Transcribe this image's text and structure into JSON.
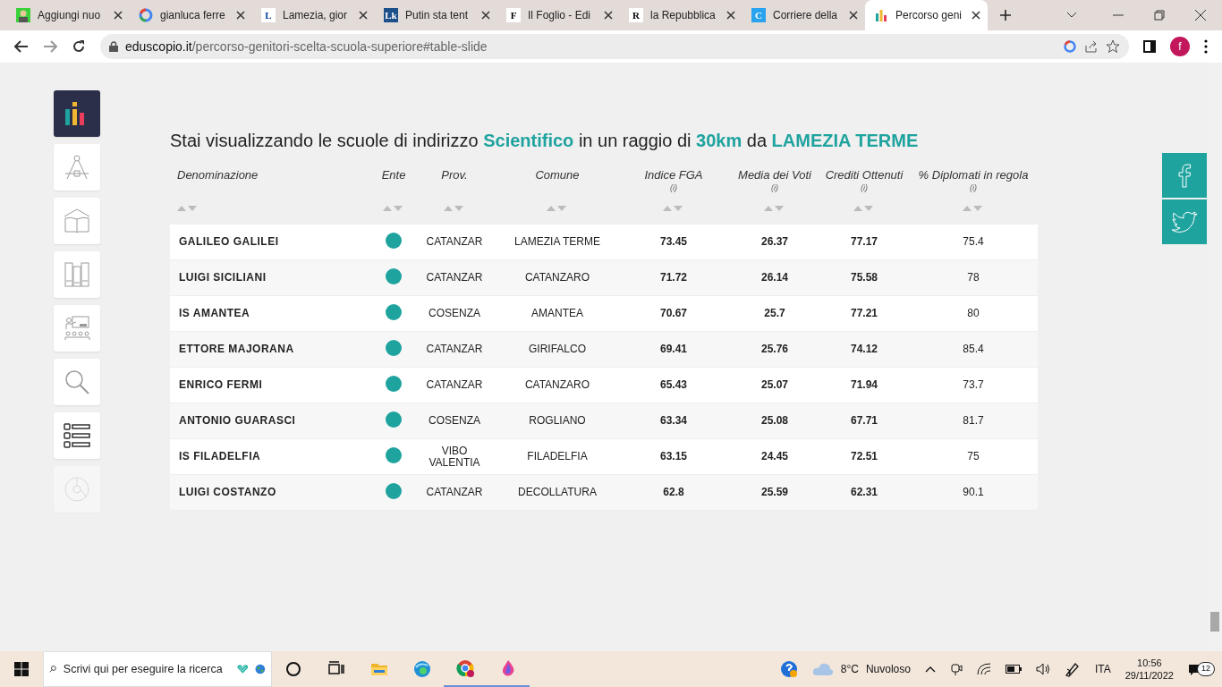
{
  "browser": {
    "tabs": [
      {
        "title": "Aggiungi nuo",
        "kind": "avatar",
        "selected": false
      },
      {
        "title": "gianluca ferre",
        "kind": "google",
        "selected": false
      },
      {
        "title": "Lamezia, gior",
        "kind": "letter",
        "favicon_text": "L",
        "selected": false
      },
      {
        "title": "Putin sta tent",
        "kind": "letter",
        "favicon_text": "Lk",
        "selected": false
      },
      {
        "title": "Il Foglio - Edi",
        "kind": "letter",
        "favicon_text": "F",
        "selected": false
      },
      {
        "title": "la Repubblica",
        "kind": "letter",
        "favicon_text": "R",
        "selected": false
      },
      {
        "title": "Corriere della",
        "kind": "letter",
        "favicon_text": "C",
        "selected": false
      },
      {
        "title": "Percorso geni",
        "kind": "bars",
        "selected": true
      }
    ],
    "url": {
      "domain": "eduscopio.it",
      "path": "/percorso-genitori-scelta-scuola-superiore#table-slide"
    },
    "profile": "f"
  },
  "sidebar": {
    "items": [
      {
        "kind": "logo",
        "selected": true,
        "disabled": false
      },
      {
        "kind": "compass",
        "selected": false,
        "disabled": false
      },
      {
        "kind": "book",
        "selected": false,
        "disabled": false
      },
      {
        "kind": "books",
        "selected": false,
        "disabled": false
      },
      {
        "kind": "classroom",
        "selected": false,
        "disabled": false
      },
      {
        "kind": "search",
        "selected": false,
        "disabled": false
      },
      {
        "kind": "list",
        "selected": false,
        "disabled": false
      },
      {
        "kind": "pie",
        "selected": false,
        "disabled": true
      }
    ]
  },
  "heading": "Stai visualizzando le scuole di indirizzo **Scientifico** in un raggio di **30km** da **LAMEZIA TERME**",
  "table": {
    "columns": [
      {
        "label": "Denominazione"
      },
      {
        "label": "Ente"
      },
      {
        "label": "Prov."
      },
      {
        "label": "Comune"
      },
      {
        "label": "Indice FGA",
        "info": "(i)"
      },
      {
        "label": "Media dei Voti",
        "info": "(i)"
      },
      {
        "label": "Crediti Ottenuti",
        "info": "(i)"
      },
      {
        "label": "% Diplomati in regola",
        "info": "(i)"
      }
    ],
    "rows": [
      {
        "name": "GALILEO GALILEI",
        "color": "#1fa39f",
        "prov": "CATANZAR",
        "comune": "LAMEZIA TERME",
        "fga": "73.45",
        "media": "26.37",
        "crediti": "77.17",
        "diplomati": "75.4"
      },
      {
        "name": "LUIGI SICILIANI",
        "color": "#1fa39f",
        "prov": "CATANZAR",
        "comune": "CATANZARO",
        "fga": "71.72",
        "media": "26.14",
        "crediti": "75.58",
        "diplomati": "78"
      },
      {
        "name": "IS AMANTEA",
        "color": "#1fa39f",
        "prov": "COSENZA",
        "comune": "AMANTEA",
        "fga": "70.67",
        "media": "25.7",
        "crediti": "77.21",
        "diplomati": "80"
      },
      {
        "name": "ETTORE MAJORANA",
        "color": "#1fa39f",
        "prov": "CATANZAR",
        "comune": "GIRIFALCO",
        "fga": "69.41",
        "media": "25.76",
        "crediti": "74.12",
        "diplomati": "85.4"
      },
      {
        "name": "ENRICO FERMI",
        "color": "#1fa39f",
        "prov": "CATANZAR",
        "comune": "CATANZARO",
        "fga": "65.43",
        "media": "25.07",
        "crediti": "71.94",
        "diplomati": "73.7"
      },
      {
        "name": "ANTONIO GUARASCI",
        "color": "#1fa39f",
        "prov": "COSENZA",
        "comune": "ROGLIANO",
        "fga": "63.34",
        "media": "25.08",
        "crediti": "67.71",
        "diplomati": "81.7"
      },
      {
        "name": "IS FILADELFIA",
        "color": "#1fa39f",
        "prov": "VIBO VALENTIA",
        "comune": "FILADELFIA",
        "fga": "63.15",
        "media": "24.45",
        "crediti": "72.51",
        "diplomati": "75"
      },
      {
        "name": "LUIGI COSTANZO",
        "color": "#1fa39f",
        "prov": "CATANZAR",
        "comune": "DECOLLATURA",
        "fga": "62.8",
        "media": "25.59",
        "crediti": "62.31",
        "diplomati": "90.1"
      }
    ]
  },
  "social": [
    {
      "kind": "facebook"
    },
    {
      "kind": "twitter"
    }
  ],
  "taskbar": {
    "search_placeholder": "Scrivi qui per eseguire la ricerca",
    "apps": [
      {
        "kind": "cortana",
        "running": false
      },
      {
        "kind": "taskview",
        "running": false
      },
      {
        "kind": "folder",
        "running": false
      },
      {
        "kind": "edge",
        "running": false
      },
      {
        "kind": "chrome",
        "running": true
      },
      {
        "kind": "paint",
        "running": true
      }
    ],
    "temperature": "8°C",
    "weather": "Nuvoloso",
    "language": "ITA",
    "time": "10:56",
    "date": "29/11/2022",
    "notifications": "12"
  }
}
